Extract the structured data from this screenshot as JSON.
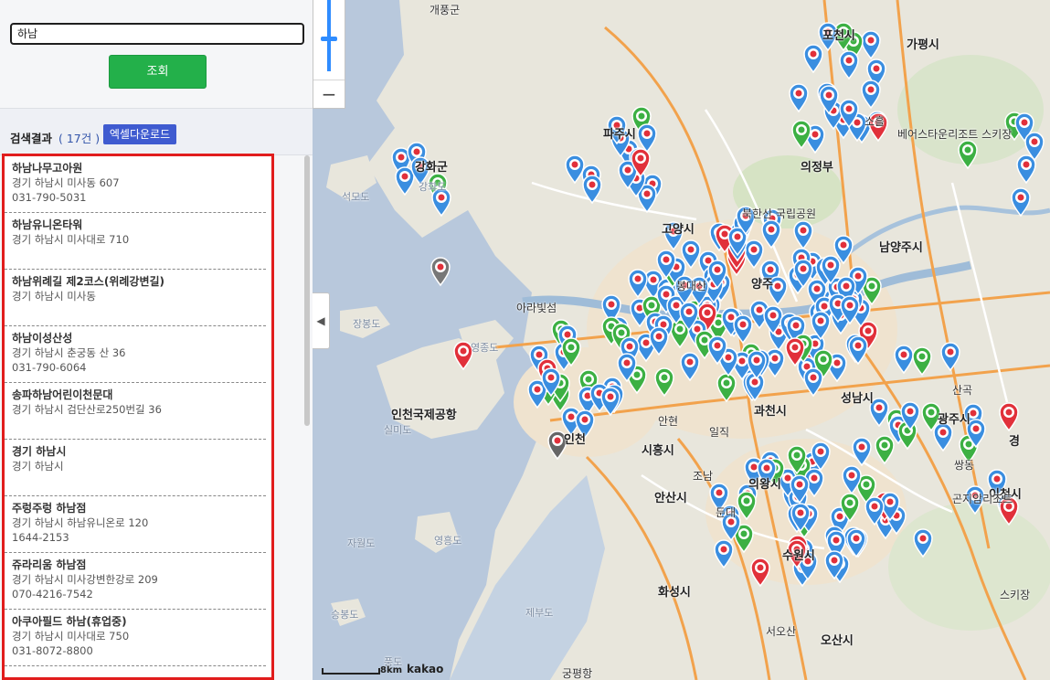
{
  "search": {
    "value": "하남",
    "button_label": "조회"
  },
  "results": {
    "title": "검색결과",
    "count_text": "( 17건 )",
    "excel_button": "엑셀다운로드",
    "items": [
      {
        "name": "하남나무고아원",
        "address": "경기 하남시 미사동 607",
        "phone": "031-790-5031"
      },
      {
        "name": "하남유니온타워",
        "address": "경기 하남시 미사대로 710",
        "phone": ""
      },
      {
        "name": "하남위례길 제2코스(위례강변길)",
        "address": "경기 하남시 미사동",
        "phone": ""
      },
      {
        "name": "하남이성산성",
        "address": "경기 하남시 춘궁동 산 36",
        "phone": "031-790-6064"
      },
      {
        "name": "송파하남어린이천문대",
        "address": "경기 하남시 검단산로250번길 36",
        "phone": ""
      },
      {
        "name": "경기 하남시",
        "address": "경기 하남시",
        "phone": ""
      },
      {
        "name": "주렁주렁 하남점",
        "address": "경기 하남시 하남유니온로 120",
        "phone": "1644-2153"
      },
      {
        "name": "쥬라리움 하남점",
        "address": "경기 하남시 미사강변한강로 209",
        "phone": "070-4216-7542"
      },
      {
        "name": "아쿠아필드 하남(휴업중)",
        "address": "경기 하남시 미사대로 750",
        "phone": "031-8072-8800"
      }
    ]
  },
  "map": {
    "zoom_out": "−",
    "collapse": "◀",
    "scale_label": "8km",
    "brand": "kakao",
    "places": [
      {
        "label": "개풍군",
        "cls": ""
      },
      {
        "label": "파주시",
        "cls": "big"
      },
      {
        "label": "강화군",
        "cls": "big"
      },
      {
        "label": "강화도",
        "cls": "sea"
      },
      {
        "label": "석모도",
        "cls": "sea"
      },
      {
        "label": "고양시",
        "cls": "big"
      },
      {
        "label": "의정부",
        "cls": "big"
      },
      {
        "label": "남양주시",
        "cls": "big"
      },
      {
        "label": "북한산 국립공원",
        "cls": ""
      },
      {
        "label": "아라빛섬",
        "cls": ""
      },
      {
        "label": "장봉도",
        "cls": "sea"
      },
      {
        "label": "영종도",
        "cls": "sea"
      },
      {
        "label": "인천국제공항",
        "cls": "big"
      },
      {
        "label": "실미도",
        "cls": "sea"
      },
      {
        "label": "인천",
        "cls": "big"
      },
      {
        "label": "시흥시",
        "cls": "big"
      },
      {
        "label": "과천시",
        "cls": "big"
      },
      {
        "label": "광주시",
        "cls": "big"
      },
      {
        "label": "성남시",
        "cls": "big"
      },
      {
        "label": "의왕시",
        "cls": "big"
      },
      {
        "label": "안산시",
        "cls": "big"
      },
      {
        "label": "수원시",
        "cls": "big"
      },
      {
        "label": "화성시",
        "cls": "big"
      },
      {
        "label": "자월도",
        "cls": "sea"
      },
      {
        "label": "영흥도",
        "cls": "sea"
      },
      {
        "label": "승봉도",
        "cls": "sea"
      },
      {
        "label": "제부도",
        "cls": "sea"
      },
      {
        "label": "풍도",
        "cls": "sea"
      },
      {
        "label": "궁평항",
        "cls": ""
      },
      {
        "label": "오산시",
        "cls": "big"
      },
      {
        "label": "이천시",
        "cls": "big"
      },
      {
        "label": "베어스타운리조트 스키장",
        "cls": ""
      },
      {
        "label": "포천시",
        "cls": "big"
      },
      {
        "label": "가평시",
        "cls": "big"
      },
      {
        "label": "양주",
        "cls": "big"
      },
      {
        "label": "경",
        "cls": "big"
      },
      {
        "label": "스키장",
        "cls": ""
      },
      {
        "label": "서오산",
        "cls": ""
      },
      {
        "label": "쌍동",
        "cls": ""
      },
      {
        "label": "산곡",
        "cls": ""
      },
      {
        "label": "소흘",
        "cls": ""
      },
      {
        "label": "봉대산",
        "cls": ""
      },
      {
        "label": "조남",
        "cls": ""
      },
      {
        "label": "둔대",
        "cls": ""
      },
      {
        "label": "안현",
        "cls": ""
      },
      {
        "label": "일직",
        "cls": ""
      },
      {
        "label": "곤지암리조트",
        "cls": ""
      }
    ]
  },
  "colors": {
    "accent_red": "#e11d1d",
    "button_green": "#23b04a",
    "button_blue": "#3f5bd0",
    "marker_red": "#e1303a",
    "marker_blue": "#3a8ee0",
    "marker_green": "#3cb043"
  }
}
